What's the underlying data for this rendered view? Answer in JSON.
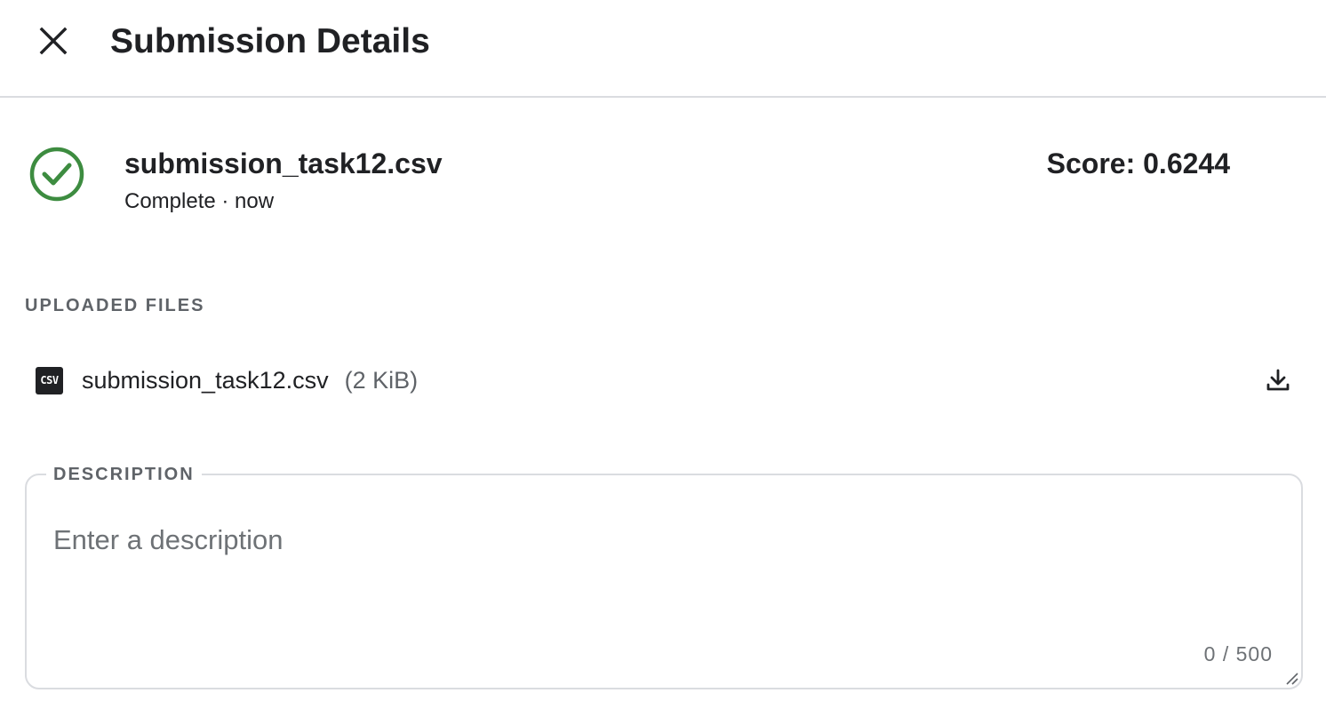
{
  "header": {
    "title": "Submission Details",
    "close_icon": "close-icon"
  },
  "submission": {
    "file_name": "submission_task12.csv",
    "status_text": "Complete · now",
    "status_icon": "check-circle-icon",
    "status_color": "#3d8c40",
    "score_text": "Score: 0.6244"
  },
  "uploaded_files": {
    "label": "UPLOADED FILES",
    "files": [
      {
        "icon": "csv-file-icon",
        "icon_text": "CSV",
        "name": "submission_task12.csv",
        "size": "(2 KiB)",
        "action_icon": "download-icon"
      }
    ]
  },
  "description": {
    "label": "DESCRIPTION",
    "placeholder": "Enter a description",
    "value": "",
    "char_count": "0 / 500"
  }
}
